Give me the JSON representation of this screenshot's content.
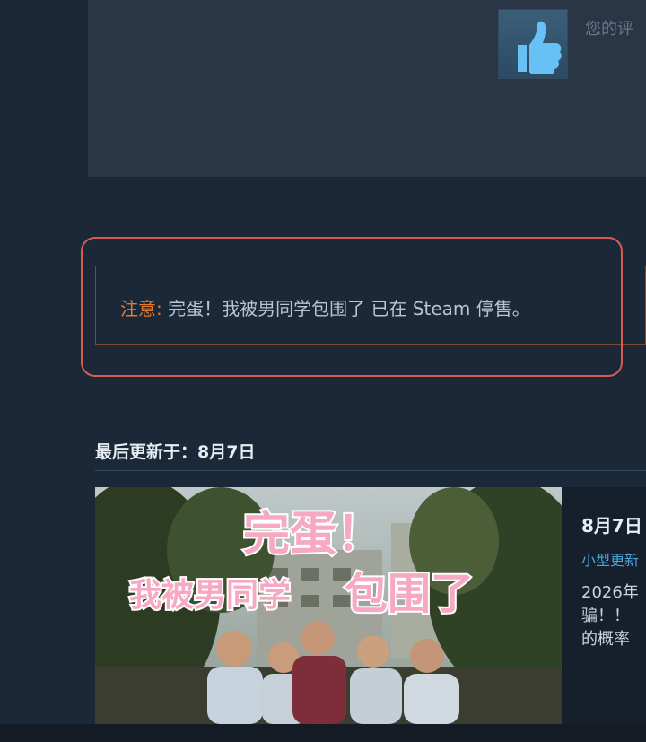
{
  "review": {
    "icon": "thumbs-up-icon",
    "text": "您的评"
  },
  "notice": {
    "label": "注意:",
    "text": "完蛋！我被男同学包围了 已在 Steam 停售。"
  },
  "updates": {
    "heading": "最后更新于：8月7日",
    "card": {
      "image_title_line1": "完蛋！",
      "image_title_line2a": "我被男同学",
      "image_title_line2b": "包围了",
      "date": "8月7日",
      "tag": "小型更新",
      "snippet_lines": [
        "2026年",
        "骗！！",
        "的概率"
      ]
    }
  },
  "colors": {
    "notice_accent": "#e07a33",
    "highlight_ring": "#d95a4e",
    "link_blue": "#4fa3d8"
  }
}
